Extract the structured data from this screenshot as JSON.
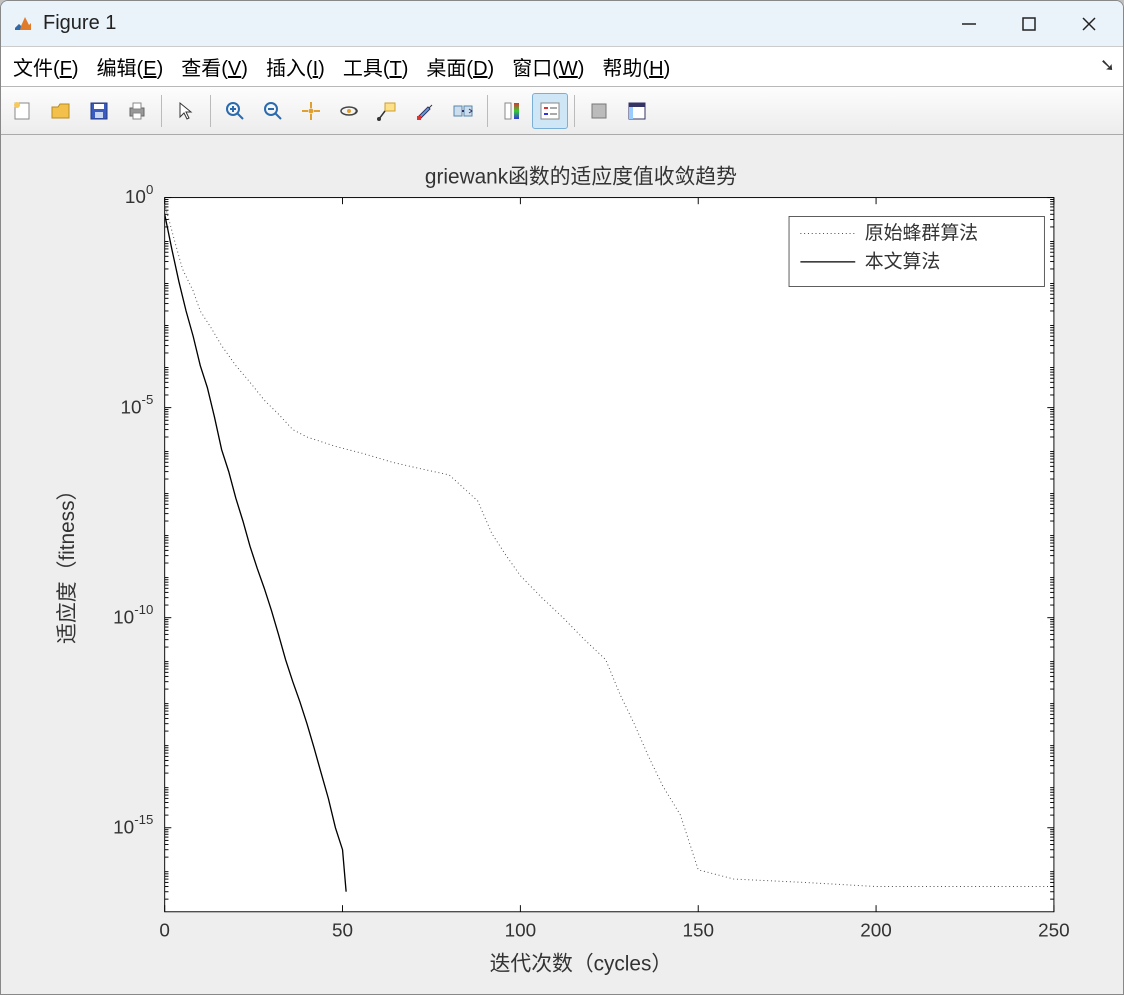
{
  "window": {
    "title": "Figure 1"
  },
  "menu": {
    "file": "文件(F)",
    "edit": "编辑(E)",
    "view": "查看(V)",
    "insert": "插入(I)",
    "tools": "工具(T)",
    "desktop": "桌面(D)",
    "window_": "窗口(W)",
    "help": "帮助(H)"
  },
  "toolbar_icons": {
    "new": "new-figure-icon",
    "open": "open-icon",
    "save": "save-icon",
    "print": "print-icon",
    "pointer": "pointer-icon",
    "zoom_in": "zoom-in-icon",
    "zoom_out": "zoom-out-icon",
    "pan": "pan-icon",
    "rotate": "rotate-3d-icon",
    "datacursor": "data-cursor-icon",
    "brush": "brush-icon",
    "link": "link-plots-icon",
    "colorbar": "colorbar-icon",
    "legend": "legend-icon",
    "hide": "hide-tools-icon",
    "dock": "dock-icon"
  },
  "chart_data": {
    "type": "line",
    "title": "griewank函数的适应度值收敛趋势",
    "xlabel": "迭代次数（cycles）",
    "ylabel": "适应度（fitness）",
    "xlim": [
      0,
      250
    ],
    "ylim": [
      1e-17,
      1
    ],
    "yscale": "log",
    "xticks": [
      0,
      50,
      100,
      150,
      200,
      250
    ],
    "yticks_exp": [
      0,
      -5,
      -10,
      -15
    ],
    "legend": [
      "原始蜂群算法",
      "本文算法"
    ],
    "legend_styles": [
      "dotted",
      "solid"
    ],
    "series": [
      {
        "name": "原始蜂群算法",
        "style": "dotted",
        "x": [
          0,
          3,
          5,
          8,
          10,
          13,
          16,
          20,
          24,
          28,
          32,
          36,
          40,
          48,
          56,
          64,
          72,
          80,
          88,
          92,
          96,
          100,
          106,
          112,
          118,
          124,
          128,
          132,
          136,
          140,
          145,
          150,
          160,
          180,
          200,
          250
        ],
        "y": [
          0.7,
          0.08,
          0.02,
          0.006,
          0.002,
          0.0008,
          0.0003,
          0.0001,
          4e-05,
          1.5e-05,
          7e-06,
          3e-06,
          2e-06,
          1.2e-06,
          8e-07,
          5e-07,
          3.5e-07,
          2.5e-07,
          6e-08,
          1e-08,
          3e-09,
          1e-09,
          3e-10,
          1e-10,
          3e-11,
          1e-11,
          1.5e-12,
          3e-13,
          5e-14,
          1e-14,
          2e-15,
          1e-16,
          6e-17,
          5e-17,
          4e-17,
          4e-17
        ]
      },
      {
        "name": "本文算法",
        "style": "solid",
        "x": [
          0,
          2,
          4,
          6,
          8,
          10,
          12,
          14,
          16,
          18,
          20,
          22,
          24,
          26,
          28,
          30,
          32,
          34,
          36,
          38,
          40,
          42,
          44,
          46,
          48,
          50,
          51
        ],
        "y": [
          0.4,
          0.06,
          0.01,
          0.002,
          0.0005,
          0.0001,
          3e-05,
          6e-06,
          1e-06,
          3e-07,
          7e-08,
          2e-08,
          5e-09,
          1.5e-09,
          5e-10,
          1.5e-10,
          4e-11,
          1e-11,
          3e-12,
          1e-12,
          3e-13,
          8e-14,
          2e-14,
          5e-15,
          1e-15,
          3e-16,
          3e-17
        ]
      }
    ]
  }
}
